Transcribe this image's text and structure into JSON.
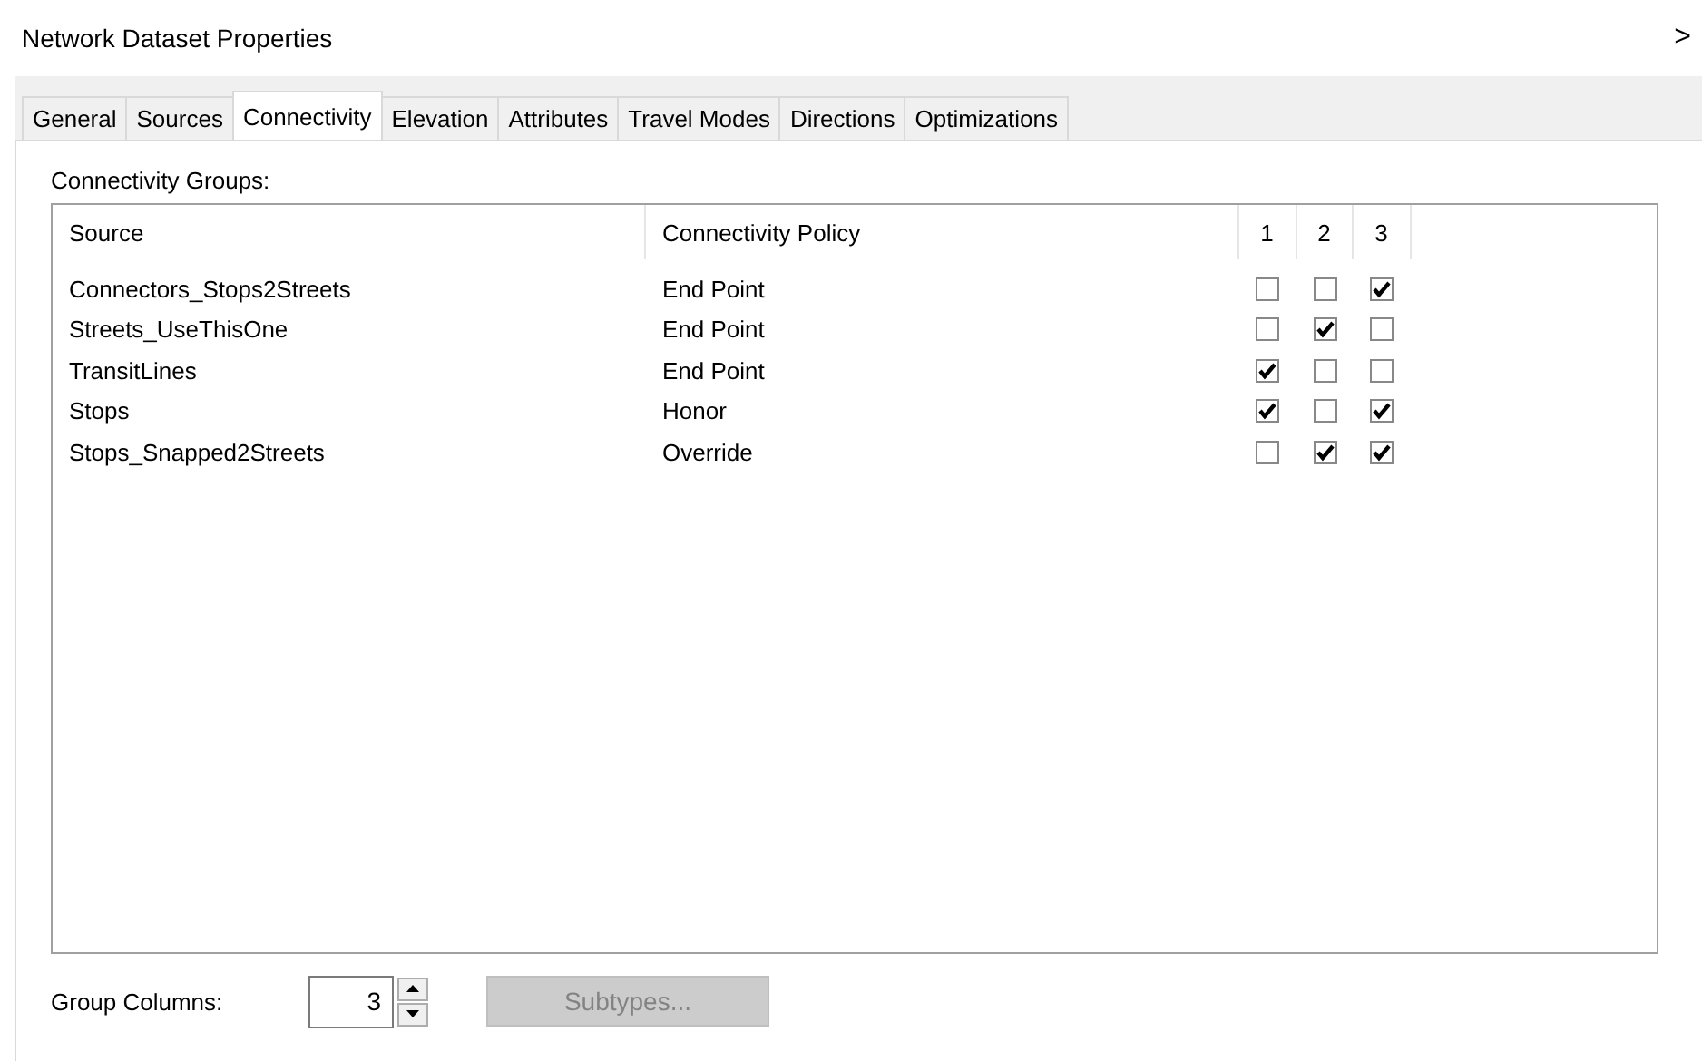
{
  "window": {
    "title": "Network Dataset Properties",
    "close": ">"
  },
  "tabs": [
    {
      "label": "General",
      "selected": false
    },
    {
      "label": "Sources",
      "selected": false
    },
    {
      "label": "Connectivity",
      "selected": true
    },
    {
      "label": "Elevation",
      "selected": false
    },
    {
      "label": "Attributes",
      "selected": false
    },
    {
      "label": "Travel Modes",
      "selected": false
    },
    {
      "label": "Directions",
      "selected": false
    },
    {
      "label": "Optimizations",
      "selected": false
    }
  ],
  "group_label": "Connectivity Groups:",
  "table": {
    "columns": [
      "Source",
      "Connectivity Policy"
    ],
    "group_columns": [
      "1",
      "2",
      "3"
    ],
    "rows": [
      {
        "source": "Connectors_Stops2Streets",
        "policy": "End Point",
        "groups": [
          false,
          false,
          true
        ]
      },
      {
        "source": "Streets_UseThisOne",
        "policy": "End Point",
        "groups": [
          false,
          true,
          false
        ]
      },
      {
        "source": "TransitLines",
        "policy": "End Point",
        "groups": [
          true,
          false,
          false
        ]
      },
      {
        "source": "Stops",
        "policy": "Honor",
        "groups": [
          true,
          false,
          true
        ]
      },
      {
        "source": "Stops_Snapped2Streets",
        "policy": "Override",
        "groups": [
          false,
          true,
          true
        ]
      }
    ]
  },
  "group_columns": {
    "label": "Group Columns:",
    "value": "3"
  },
  "subtypes_button": {
    "label": "Subtypes...",
    "disabled": true
  }
}
